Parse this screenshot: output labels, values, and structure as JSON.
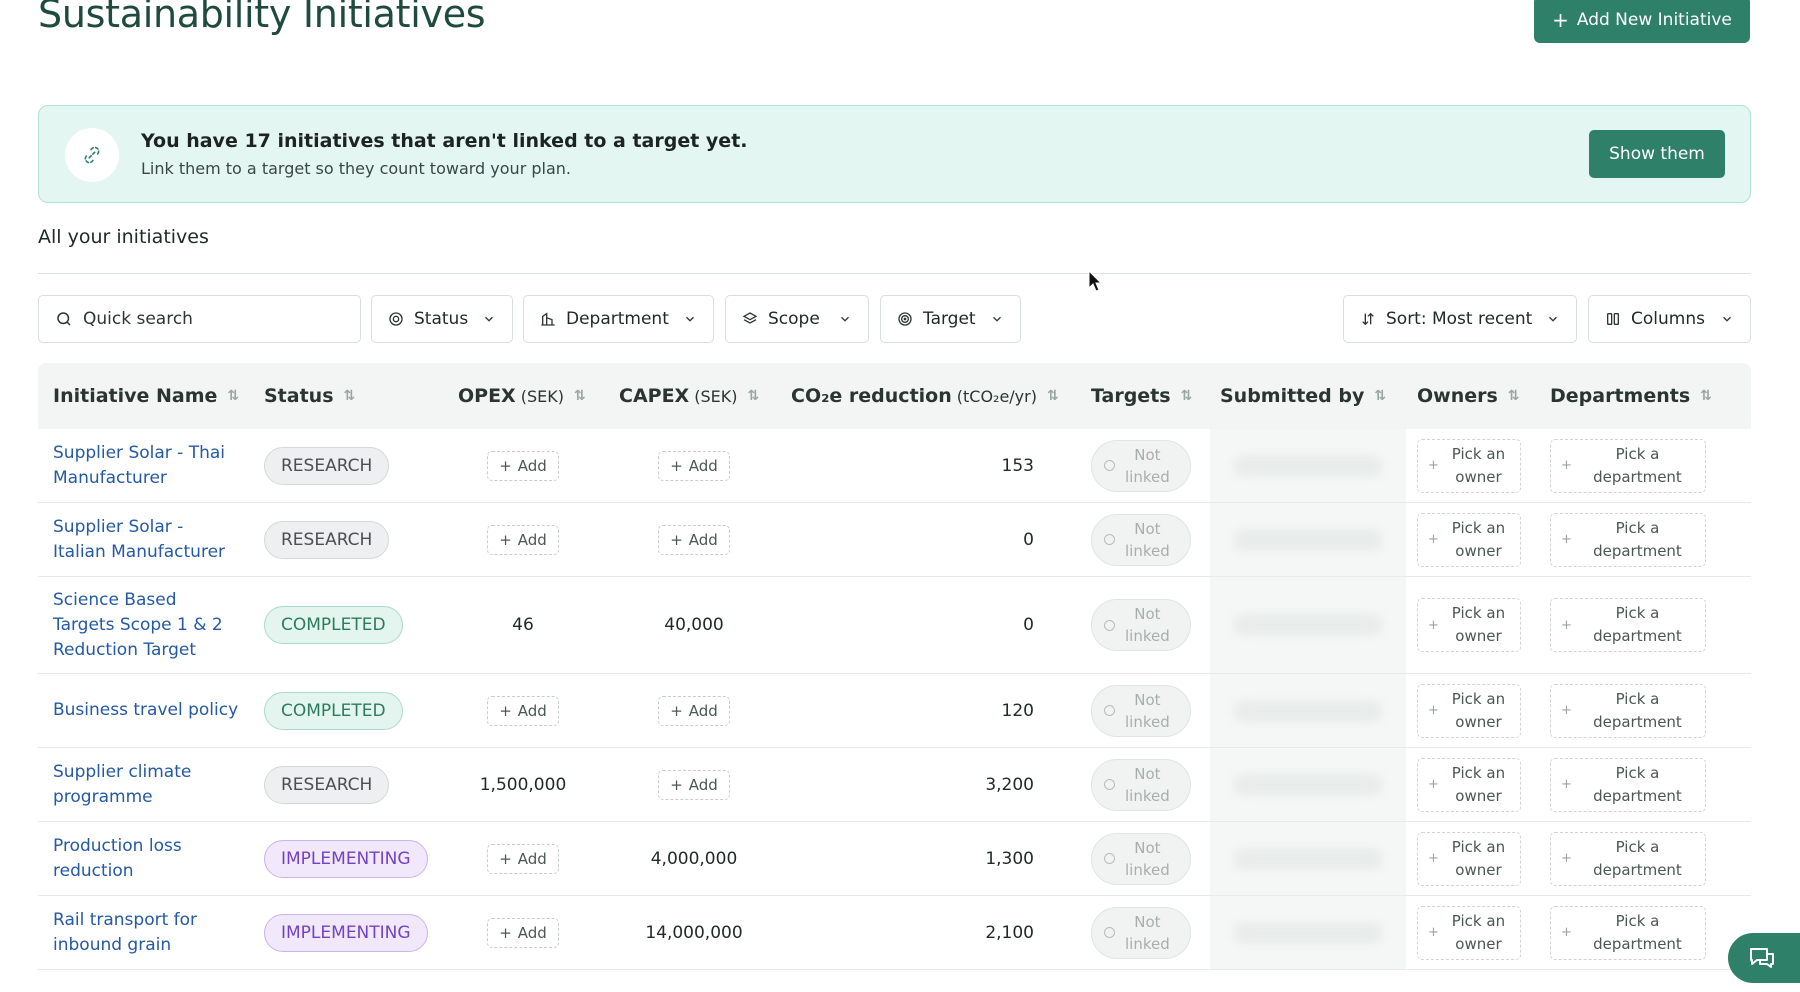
{
  "page": {
    "title": "Sustainability Initiatives",
    "add_button": "Add New Initiative"
  },
  "banner": {
    "title": "You have 17 initiatives that aren't linked to a target yet.",
    "subtitle": "Link them to a target so they count toward your plan.",
    "button": "Show them"
  },
  "section": {
    "title": "All your initiatives"
  },
  "toolbar": {
    "search_placeholder": "Quick search",
    "filters": {
      "status": "Status",
      "department": "Department",
      "scope": "Scope",
      "target": "Target"
    },
    "sort": "Sort: Most recent",
    "columns": "Columns"
  },
  "table": {
    "headers": {
      "name": "Initiative Name",
      "status": "Status",
      "opex": "OPEX",
      "opex_unit": "(SEK)",
      "capex": "CAPEX",
      "capex_unit": "(SEK)",
      "co2": "CO₂e reduction",
      "co2_unit": "(tCO₂e/yr)",
      "targets": "Targets",
      "submitted": "Submitted by",
      "owners": "Owners",
      "departments": "Departments"
    },
    "add_label": "Add",
    "not_linked_1": "Not",
    "not_linked_2": "linked",
    "pick_owner_1": "Pick an",
    "pick_owner_2": "owner",
    "pick_dept_1": "Pick a",
    "pick_dept_2": "department",
    "rows": [
      {
        "name": [
          "Supplier Solar - Thai",
          "Manufacturer"
        ],
        "status": "RESEARCH",
        "status_kind": "research",
        "opex": null,
        "capex": null,
        "co2": "153"
      },
      {
        "name": [
          "Supplier Solar -",
          "Italian Manufacturer"
        ],
        "status": "RESEARCH",
        "status_kind": "research",
        "opex": null,
        "capex": null,
        "co2": "0"
      },
      {
        "name": [
          "Science Based",
          "Targets Scope 1 & 2",
          "Reduction Target"
        ],
        "status": "COMPLETED",
        "status_kind": "completed",
        "opex": "46",
        "capex": "40,000",
        "co2": "0"
      },
      {
        "name": [
          "Business travel policy"
        ],
        "status": "COMPLETED",
        "status_kind": "completed",
        "opex": null,
        "capex": null,
        "co2": "120"
      },
      {
        "name": [
          "Supplier climate",
          "programme"
        ],
        "status": "RESEARCH",
        "status_kind": "research",
        "opex": "1,500,000",
        "capex": null,
        "co2": "3,200"
      },
      {
        "name": [
          "Production loss",
          "reduction"
        ],
        "status": "IMPLEMENTING",
        "status_kind": "implementing",
        "opex": null,
        "capex": "4,000,000",
        "co2": "1,300"
      },
      {
        "name": [
          "Rail transport for",
          "inbound grain"
        ],
        "status": "IMPLEMENTING",
        "status_kind": "implementing",
        "opex": null,
        "capex": "14,000,000",
        "co2": "2,100"
      }
    ]
  },
  "colors": {
    "brand": "#2f8069",
    "banner_bg": "#e3f6f1",
    "link": "#2459a3"
  },
  "icons": [
    "link-break-icon",
    "search-icon",
    "status-icon",
    "department-icon",
    "scope-icon",
    "target-icon",
    "sort-icon",
    "columns-icon",
    "chevron-down-icon",
    "sort-arrows-icon",
    "plus-icon",
    "chat-icon"
  ]
}
